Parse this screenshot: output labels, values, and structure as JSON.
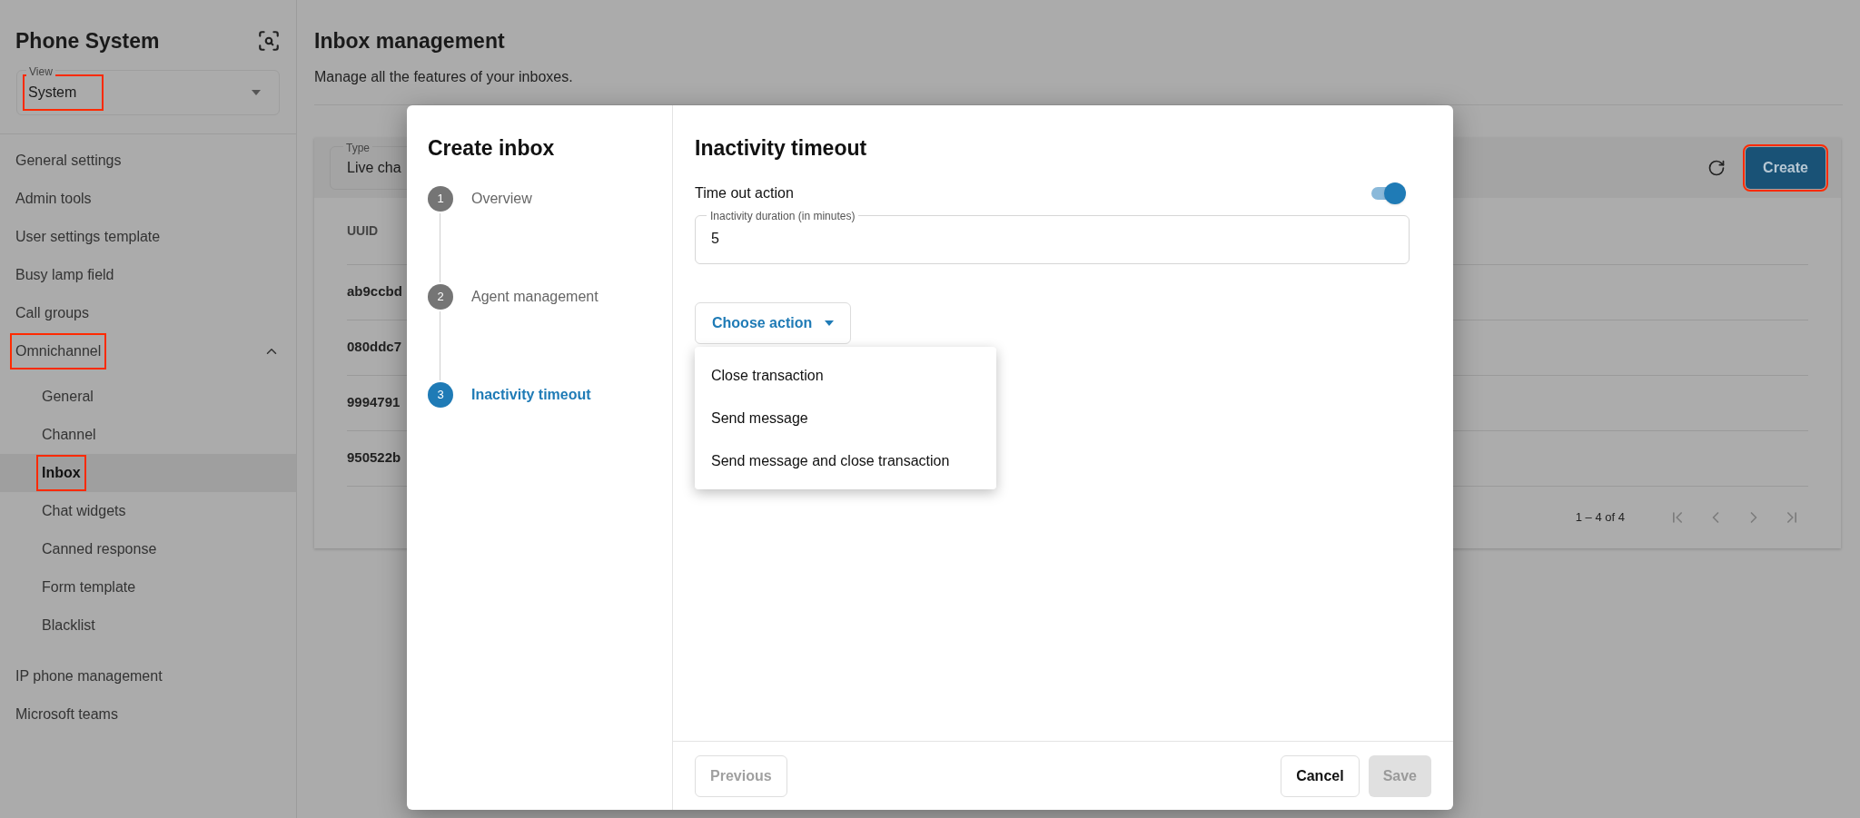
{
  "sidebar": {
    "title": "Phone System",
    "view": {
      "label": "View",
      "value": "System",
      "highlighted": true
    },
    "items": [
      {
        "label": "General settings",
        "selected": false,
        "highlighted": false
      },
      {
        "label": "Admin tools",
        "selected": false,
        "highlighted": false
      },
      {
        "label": "User settings template",
        "selected": false,
        "highlighted": false
      },
      {
        "label": "Busy lamp field",
        "selected": false,
        "highlighted": false
      },
      {
        "label": "Call groups",
        "selected": false,
        "highlighted": false
      },
      {
        "label": "Omnichannel",
        "selected": false,
        "highlighted": true,
        "expanded": true,
        "children": [
          {
            "label": "General",
            "selected": false,
            "highlighted": false
          },
          {
            "label": "Channel",
            "selected": false,
            "highlighted": false
          },
          {
            "label": "Inbox",
            "selected": true,
            "highlighted": true
          },
          {
            "label": "Chat widgets",
            "selected": false,
            "highlighted": false
          },
          {
            "label": "Canned response",
            "selected": false,
            "highlighted": false
          },
          {
            "label": "Form template",
            "selected": false,
            "highlighted": false
          },
          {
            "label": "Blacklist",
            "selected": false,
            "highlighted": false
          }
        ]
      },
      {
        "label": "IP phone management",
        "selected": false,
        "highlighted": false
      },
      {
        "label": "Microsoft teams",
        "selected": false,
        "highlighted": false
      }
    ]
  },
  "page": {
    "title": "Inbox management",
    "subtitle": "Manage all the features of your inboxes.",
    "type_filter": {
      "label": "Type",
      "value": "Live cha"
    },
    "create_button": {
      "label": "Create",
      "highlighted": true
    },
    "table": {
      "columns": [
        "UUID"
      ],
      "rows": [
        [
          "ab9ccbd"
        ],
        [
          "080ddc7"
        ],
        [
          "9994791"
        ],
        [
          "950522b"
        ]
      ]
    },
    "pagination": "1 – 4 of 4"
  },
  "dialog": {
    "title": "Create inbox",
    "steps": [
      {
        "number": "1",
        "label": "Overview",
        "active": false
      },
      {
        "number": "2",
        "label": "Agent management",
        "active": false
      },
      {
        "number": "3",
        "label": "Inactivity timeout",
        "active": true
      }
    ],
    "section_title": "Inactivity timeout",
    "toggle": {
      "label": "Time out action",
      "on": true
    },
    "duration_field": {
      "label": "Inactivity duration (in minutes)",
      "value": "5"
    },
    "action_button": {
      "label": "Choose action"
    },
    "action_menu": [
      "Close transaction",
      "Send message",
      "Send message and close transaction"
    ],
    "footer": {
      "previous": {
        "label": "Previous",
        "disabled": true
      },
      "cancel": {
        "label": "Cancel",
        "disabled": false
      },
      "save": {
        "label": "Save",
        "disabled": true
      }
    }
  }
}
